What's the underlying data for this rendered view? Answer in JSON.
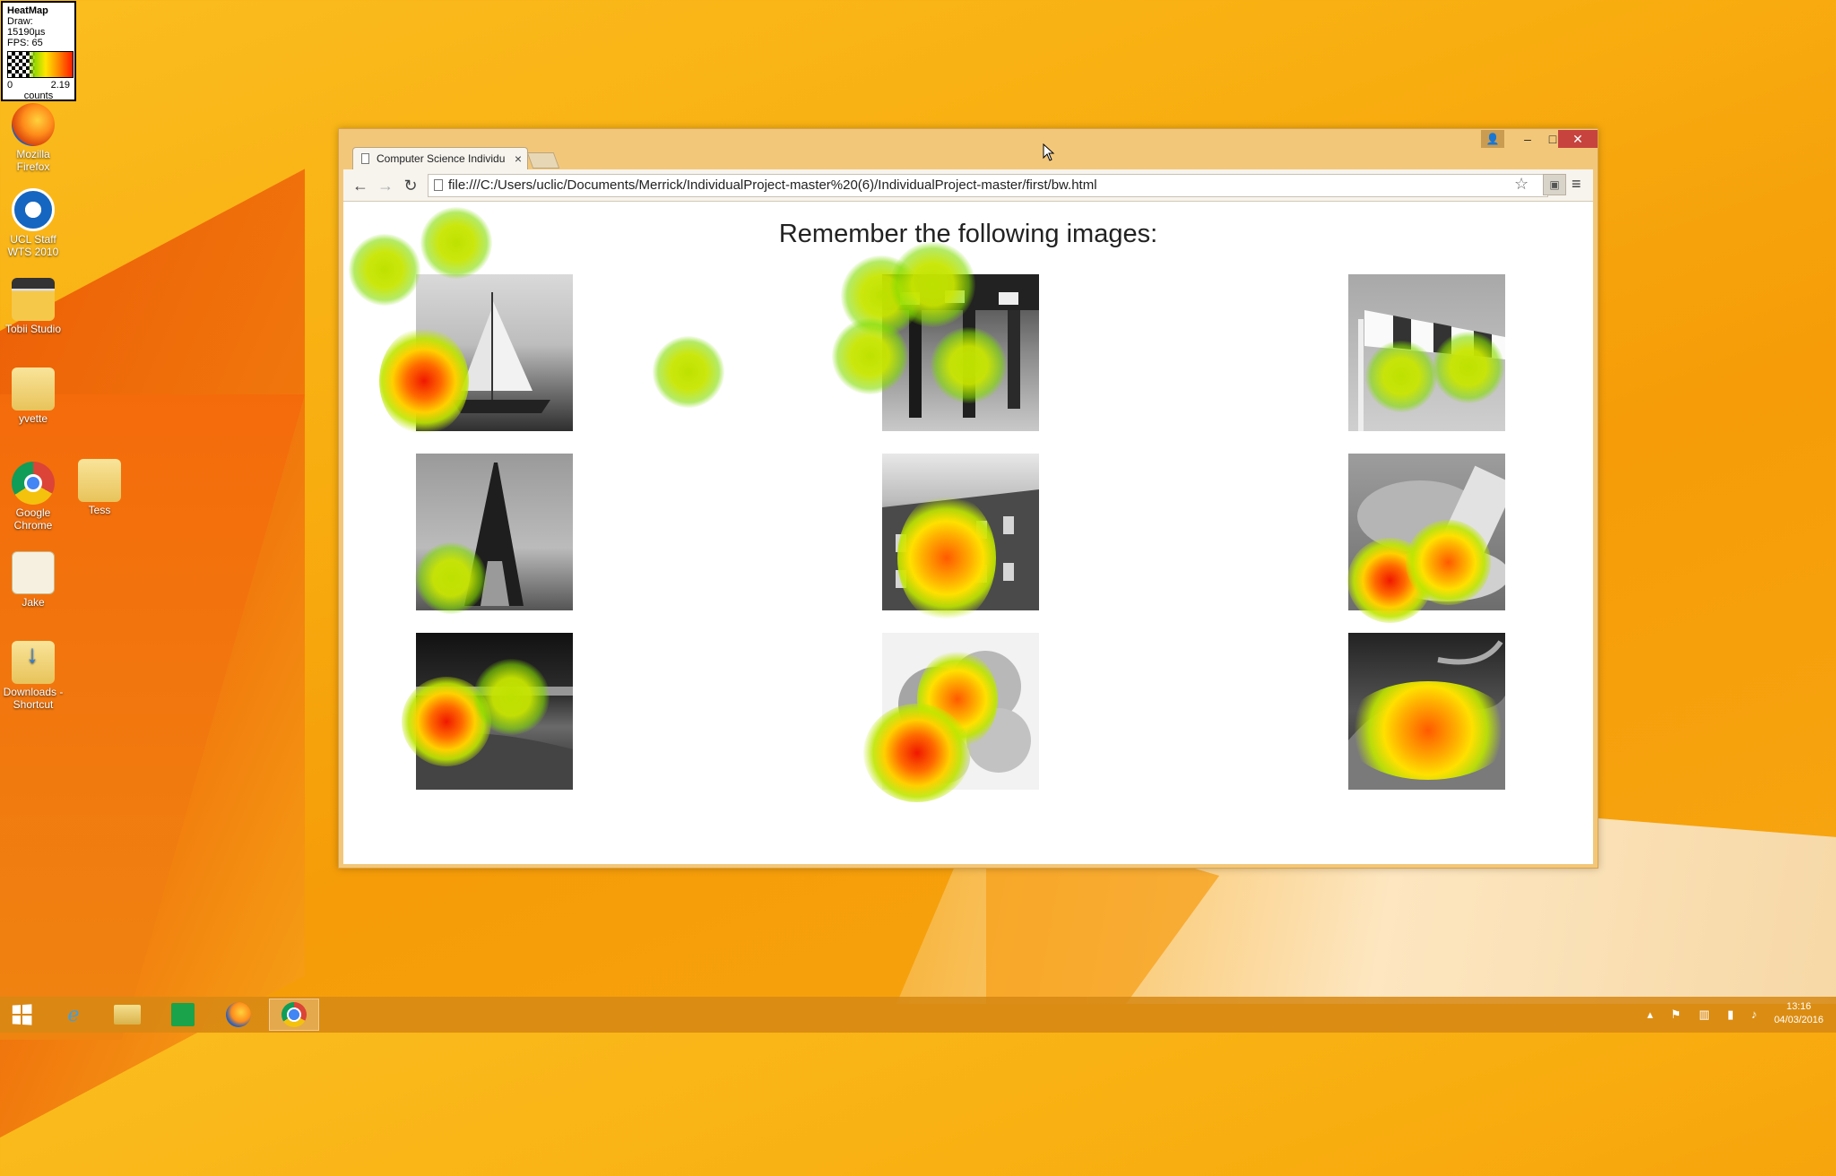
{
  "heatmap_legend": {
    "title": "HeatMap",
    "draw": "Draw: 15190µs",
    "fps": "FPS: 65",
    "min": "0",
    "max": "2.19",
    "units": "counts"
  },
  "desktop_icons": [
    {
      "label": "Mozilla Firefox",
      "icon": "firefox-icon"
    },
    {
      "label": "UCL Staff WTS 2010",
      "icon": "remote-desktop-icon"
    },
    {
      "label": "Tobii Studio",
      "icon": "tobii-studio-icon"
    },
    {
      "label": "yvette",
      "icon": "folder-icon"
    },
    {
      "label": "Google Chrome",
      "icon": "chrome-icon"
    },
    {
      "label": "Tess",
      "icon": "folder-icon"
    },
    {
      "label": "Jake",
      "icon": "document-icon"
    },
    {
      "label": "Downloads - Shortcut",
      "icon": "downloads-shortcut-icon"
    }
  ],
  "browser": {
    "tab_title": "Computer Science Individu",
    "url": "file:///C:/Users/uclic/Documents/Merrick/IndividualProject-master%20(6)/IndividualProject-master/first/bw.html",
    "controls": {
      "minimize": "–",
      "maximize": "□",
      "close": "✕"
    }
  },
  "page": {
    "heading": "Remember the following images:",
    "images": [
      {
        "subject": "sailing ship",
        "fill": "#6e6e6e"
      },
      {
        "subject": "runners' legs",
        "fill": "#4a4a4a"
      },
      {
        "subject": "windsock",
        "fill": "#9a9a9a"
      },
      {
        "subject": "Eiffel Tower",
        "fill": "#7a7a7a"
      },
      {
        "subject": "brick building",
        "fill": "#5c5c5c"
      },
      {
        "subject": "bread basket",
        "fill": "#888888"
      },
      {
        "subject": "city at night",
        "fill": "#2a2a2a"
      },
      {
        "subject": "oranges",
        "fill": "#c8c8c8"
      },
      {
        "subject": "dragon statue",
        "fill": "#3c3c3c"
      }
    ]
  },
  "taskbar": {
    "items": [
      "start-icon",
      "internet-explorer-icon",
      "file-explorer-icon",
      "store-icon",
      "firefox-icon",
      "chrome-icon"
    ],
    "active": "chrome-icon",
    "time": "13:16",
    "date": "04/03/2016"
  }
}
